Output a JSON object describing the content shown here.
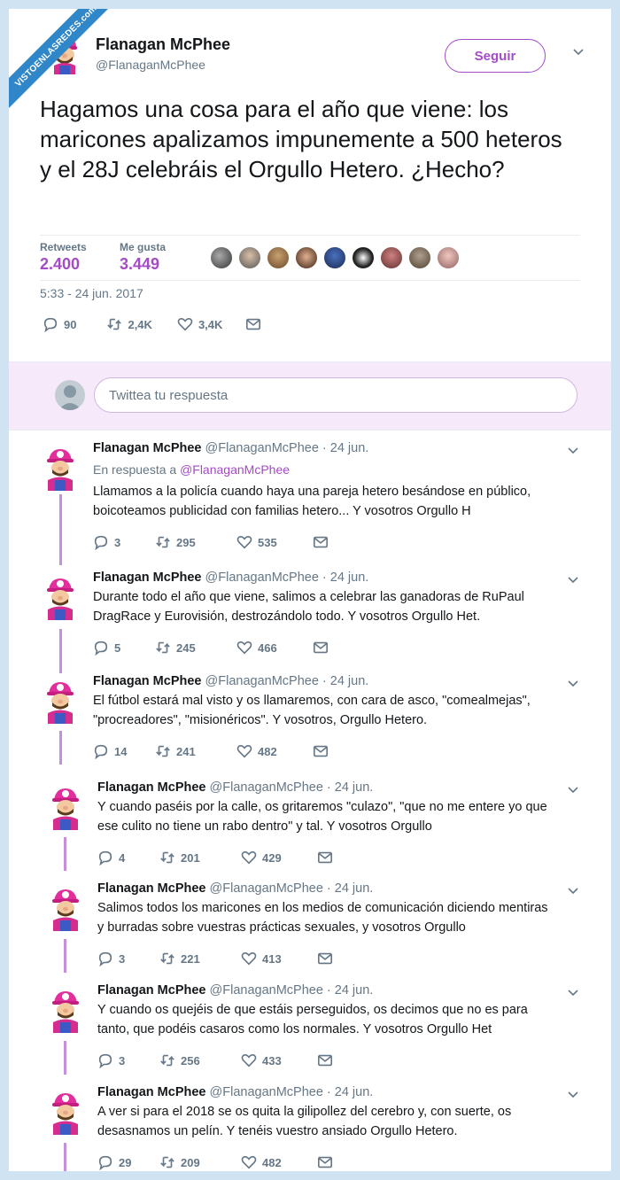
{
  "watermark": "VISTOENLASREDES.com",
  "main_tweet": {
    "author_name": "Flanagan McPhee",
    "author_handle": "@FlanaganMcPhee",
    "follow_label": "Seguir",
    "text": "Hagamos una cosa para el año que viene: los maricones apalizamos impunemente a 500 heteros y el 28J celebráis el Orgullo Hetero. ¿Hecho?",
    "retweets_label": "Retweets",
    "retweets_value": "2.400",
    "likes_label": "Me gusta",
    "likes_value": "3.449",
    "timestamp": "5:33 - 24 jun. 2017",
    "replies": "90",
    "retweets_short": "2,4K",
    "likes_short": "3,4K"
  },
  "reply_box": {
    "placeholder": "Twittea tu respuesta"
  },
  "replies": [
    {
      "name": "Flanagan McPhee",
      "meta": "@FlanaganMcPhee · 24 jun.",
      "in_reply_prefix": "En respuesta a ",
      "in_reply_handle": "@FlanaganMcPhee",
      "line1": "Llamamos a la policía cuando haya una pareja hetero besándose en público,",
      "line2": "boicoteamos publicidad con familias hetero... Y vosotros Orgullo H",
      "replies": "3",
      "retweets": "295",
      "likes": "535"
    },
    {
      "name": "Flanagan McPhee",
      "meta": "@FlanaganMcPhee · 24 jun.",
      "line1": "Durante todo el año que viene, salimos a celebrar las ganadoras de RuPaul",
      "line2": "DragRace y Eurovisión, destrozándolo todo. Y vosotros Orgullo Het.",
      "replies": "5",
      "retweets": "245",
      "likes": "466"
    },
    {
      "name": "Flanagan McPhee",
      "meta": "@FlanaganMcPhee · 24 jun.",
      "line1": "El fútbol estará mal visto y os llamaremos, con cara de asco, \"comealmejas\",",
      "line2": "\"procreadores\", \"misionéricos\". Y vosotros, Orgullo Hetero.",
      "replies": "14",
      "retweets": "241",
      "likes": "482"
    },
    {
      "name": "Flanagan McPhee",
      "meta": "@FlanaganMcPhee · 24 jun.",
      "line1": "Y cuando paséis por la calle, os gritaremos \"culazo\", \"que no me entere yo que",
      "line2": "ese culito no tiene un rabo dentro\" y tal. Y vosotros Orgullo",
      "replies": "4",
      "retweets": "201",
      "likes": "429"
    },
    {
      "name": "Flanagan McPhee",
      "meta": "@FlanaganMcPhee · 24 jun.",
      "line1": "Salimos todos los maricones en los medios de comunicación diciendo mentiras",
      "line2": "y burradas sobre vuestras prácticas sexuales, y vosotros Orgullo",
      "replies": "3",
      "retweets": "221",
      "likes": "413"
    },
    {
      "name": "Flanagan McPhee",
      "meta": "@FlanaganMcPhee · 24 jun.",
      "line1": "Y cuando os quejéis de que estáis perseguidos, os decimos que no es para",
      "line2": "tanto, que podéis casaros como los normales. Y vosotros Orgullo Het",
      "replies": "3",
      "retweets": "256",
      "likes": "433"
    },
    {
      "name": "Flanagan McPhee",
      "meta": "@FlanaganMcPhee · 24 jun.",
      "line1": "A ver si para el 2018 se os quita la gilipollez del cerebro y, con suerte, os",
      "line2": "desasnamos un pelín. Y tenéis vuestro ansiado Orgullo Hetero.",
      "replies": "29",
      "retweets": "209",
      "likes": "482"
    }
  ],
  "colors": {
    "accent": "#a44bc6",
    "muted": "#657786",
    "thread": "#c58fd9",
    "reply_bg": "#f5e9fa",
    "page_bg": "#cfe3f3"
  }
}
